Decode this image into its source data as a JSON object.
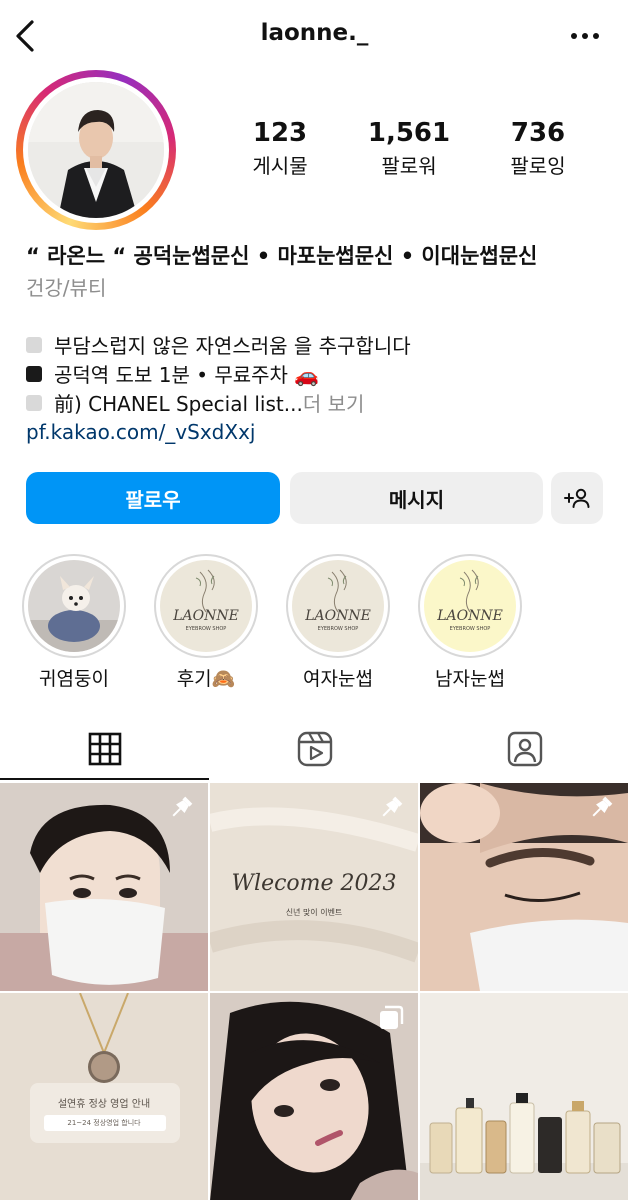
{
  "header": {
    "username": "laonne._",
    "back_icon": "chevron-left-icon",
    "more_icon": "more-horizontal-icon"
  },
  "stats": [
    {
      "value": "123",
      "label": "게시물"
    },
    {
      "value": "1,561",
      "label": "팔로워"
    },
    {
      "value": "736",
      "label": "팔로잉"
    }
  ],
  "bio": {
    "name": "“ 라온느 “ 공덕눈썹문신 • 마포눈썹문신 • 이대눈썹문신",
    "category": "건강/뷰티",
    "lines": [
      "부담스럽지 않은 자연스러움 을 추구합니다",
      "공덕역 도보 1분 • 무료주차 🚗",
      "前) CHANEL Special list..."
    ],
    "more_label": " 더 보기",
    "link": "pf.kakao.com/_vSxdXxj"
  },
  "buttons": {
    "follow": "팔로우",
    "message": "메시지",
    "add_user_icon": "add-user-icon"
  },
  "highlights": [
    {
      "label": "귀염둥이"
    },
    {
      "label": "후기🙈",
      "logo_text": "LAONNE"
    },
    {
      "label": "여자눈썹",
      "logo_text": "LAONNE"
    },
    {
      "label": "남자눈썹",
      "logo_text": "LAONNE"
    }
  ],
  "highlight_logo_subtext": "EYEBROW SHOP",
  "posts": [
    {
      "pinned": true
    },
    {
      "pinned": true,
      "title": "Wlecome 2023",
      "subtitle": "신년 맞이 이벤트"
    },
    {
      "pinned": true
    },
    {
      "pinned": false,
      "title": "설연휴 정상 영업 안내",
      "subtitle": "21~24 정상영업 합니다"
    },
    {
      "pinned": false,
      "multi": true
    },
    {
      "pinned": false
    }
  ],
  "colors": {
    "follow_blue": "#0095f6",
    "link_blue": "#00376b",
    "muted": "#8e8e8e",
    "button_gray": "#efefef"
  }
}
